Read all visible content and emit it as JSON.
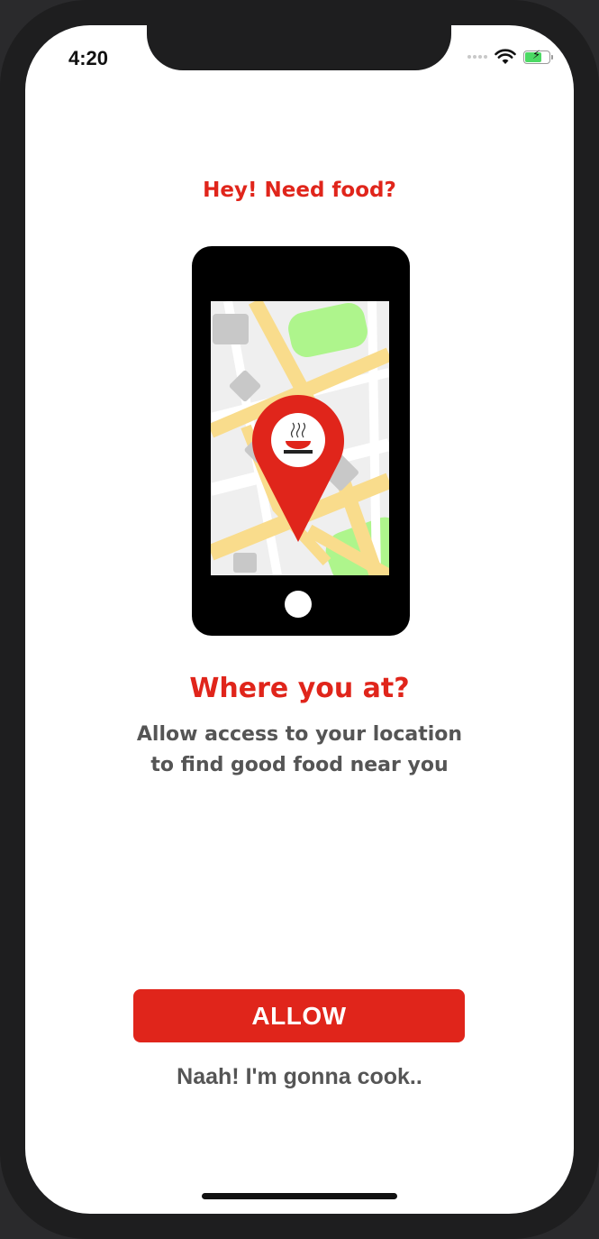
{
  "status_bar": {
    "time": "4:20",
    "icons": [
      "cellular-signal-icon",
      "wifi-icon",
      "battery-charging-icon"
    ]
  },
  "onboarding": {
    "headline": "Hey! Need food?",
    "illustration": "phone-map-location-pin",
    "title": "Where you at?",
    "subtitle_line1": "Allow access to your location",
    "subtitle_line2": "to find good food near you"
  },
  "actions": {
    "allow_label": "ALLOW",
    "decline_label": "Naah! I'm gonna cook.."
  },
  "colors": {
    "accent": "#e0251b",
    "text_secondary": "#555555",
    "map_green": "#aef58c",
    "map_road": "#f9dc8c"
  }
}
